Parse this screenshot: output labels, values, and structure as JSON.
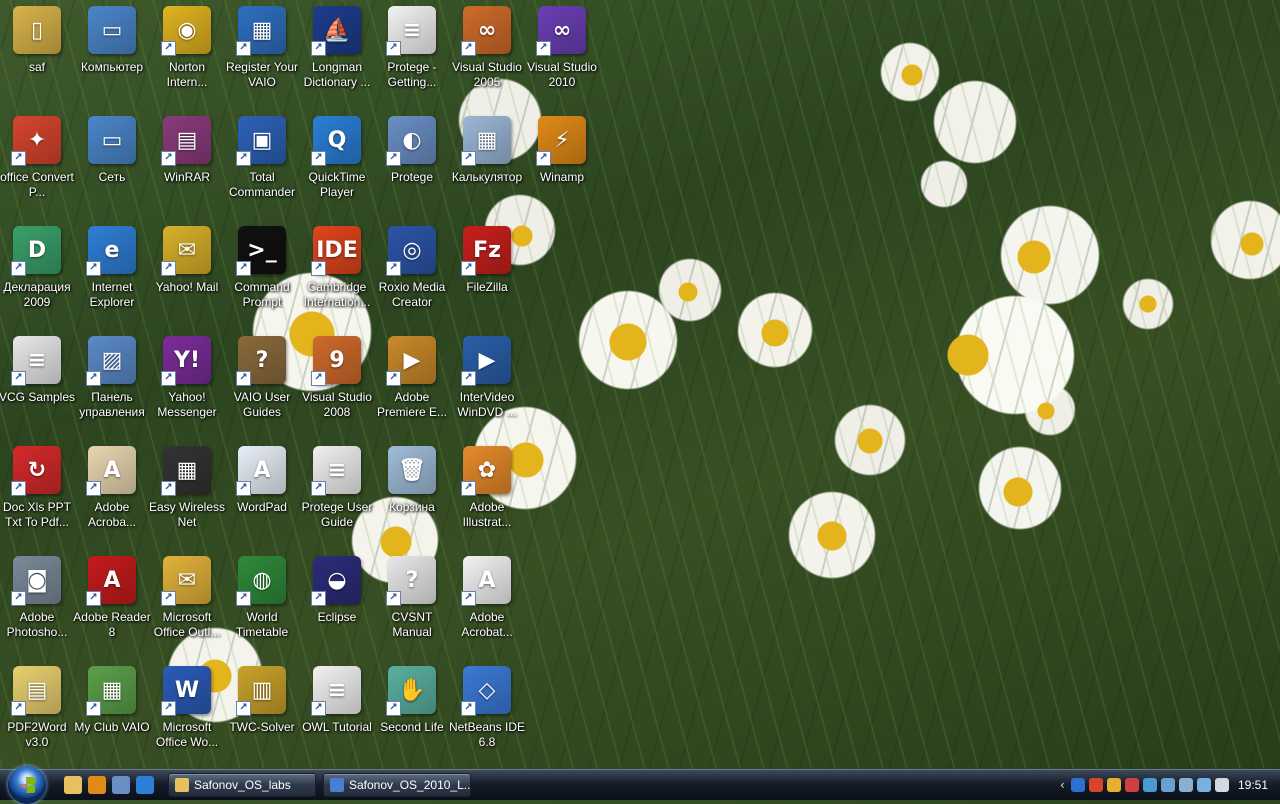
{
  "desktop": {
    "icons": [
      {
        "label": "saf",
        "color": "#d8b34a",
        "glyph": "▯"
      },
      {
        "label": "Компьютер",
        "color": "#4b86c9",
        "glyph": "▭"
      },
      {
        "label": "Norton Intern...",
        "color": "#e0b321",
        "glyph": "◉"
      },
      {
        "label": "Register Your VAIO",
        "color": "#2f6fc0",
        "glyph": "▦"
      },
      {
        "label": "Longman Dictionary ...",
        "color": "#1e3c8c",
        "glyph": "⛵"
      },
      {
        "label": "Protege - Getting...",
        "color": "#f2f2f2",
        "glyph": "≡"
      },
      {
        "label": "Visual Studio 2005",
        "color": "#cf6b2a",
        "glyph": "∞"
      },
      {
        "label": "Visual Studio 2010",
        "color": "#6b3fb5",
        "glyph": "∞"
      },
      {
        "label": "office Convert P...",
        "color": "#d6452e",
        "glyph": "✦"
      },
      {
        "label": "Сеть",
        "color": "#4b86c9",
        "glyph": "▭"
      },
      {
        "label": "WinRAR",
        "color": "#8a3b7c",
        "glyph": "▤"
      },
      {
        "label": "Total Commander",
        "color": "#2d62b8",
        "glyph": "▣"
      },
      {
        "label": "QuickTime Player",
        "color": "#2a7fd6",
        "glyph": "Q"
      },
      {
        "label": "Protege",
        "color": "#6a8fc4",
        "glyph": "◐"
      },
      {
        "label": "Калькулятор",
        "color": "#9bb7d6",
        "glyph": "▦"
      },
      {
        "label": "Winamp",
        "color": "#e08a18",
        "glyph": "⚡"
      },
      {
        "label": "Декларация 2009",
        "color": "#3aa06a",
        "glyph": "D"
      },
      {
        "label": "Internet Explorer",
        "color": "#2f7fd6",
        "glyph": "e"
      },
      {
        "label": "Yahoo! Mail",
        "color": "#d9b02a",
        "glyph": "✉"
      },
      {
        "label": "Command Prompt",
        "color": "#111111",
        "glyph": ">_"
      },
      {
        "label": "Cambridge Internation...",
        "color": "#e0451c",
        "glyph": "IDE"
      },
      {
        "label": "Roxio Media Creator",
        "color": "#2c55a8",
        "glyph": "◎"
      },
      {
        "label": "FileZilla",
        "color": "#c8201c",
        "glyph": "Fz"
      },
      {
        "label": "VCG Samples",
        "color": "#e8e8e8",
        "glyph": "≡"
      },
      {
        "label": "Панель управления",
        "color": "#5b8ac8",
        "glyph": "▨"
      },
      {
        "label": "Yahoo! Messenger",
        "color": "#7b2d9a",
        "glyph": "Y!"
      },
      {
        "label": "VAIO User Guides",
        "color": "#8a6a3c",
        "glyph": "?"
      },
      {
        "label": "Visual Studio 2008",
        "color": "#d06a2b",
        "glyph": "9"
      },
      {
        "label": "Adobe Premiere E...",
        "color": "#c98a2a",
        "glyph": "▶"
      },
      {
        "label": "InterVideo WinDVD ...",
        "color": "#2a5fa8",
        "glyph": "▶"
      },
      {
        "label": "Doc Xls PPT Txt To Pdf...",
        "color": "#d42a2a",
        "glyph": "↻"
      },
      {
        "label": "Adobe Acroba...",
        "color": "#e8d6b0",
        "glyph": "A"
      },
      {
        "label": "Easy Wireless Net",
        "color": "#333333",
        "glyph": "▦"
      },
      {
        "label": "WordPad",
        "color": "#e8eef8",
        "glyph": "A"
      },
      {
        "label": "Protege User Guide",
        "color": "#f0f0f0",
        "glyph": "≡"
      },
      {
        "label": "Корзина",
        "color": "#9fbcd8",
        "glyph": "🗑"
      },
      {
        "label": "Adobe Illustrat...",
        "color": "#e58a2a",
        "glyph": "✿"
      },
      {
        "label": "Adobe Photosho...",
        "color": "#7a8a9a",
        "glyph": "◙"
      },
      {
        "label": "Adobe Reader 8",
        "color": "#c41c1c",
        "glyph": "A"
      },
      {
        "label": "Microsoft Office Outl...",
        "color": "#e2b23a",
        "glyph": "✉"
      },
      {
        "label": "World Timetable",
        "color": "#2f8a3a",
        "glyph": "◍"
      },
      {
        "label": "Eclipse",
        "color": "#2c2c7a",
        "glyph": "◒"
      },
      {
        "label": "CVSNT Manual",
        "color": "#e8e8e8",
        "glyph": "?"
      },
      {
        "label": "Adobe Acrobat...",
        "color": "#f2f2f2",
        "glyph": "A"
      },
      {
        "label": "PDF2Word v3.0",
        "color": "#e8d070",
        "glyph": "▤"
      },
      {
        "label": "My Club VAIO",
        "color": "#5aa04a",
        "glyph": "▦"
      },
      {
        "label": "Microsoft Office Wo...",
        "color": "#2b5bb8",
        "glyph": "W"
      },
      {
        "label": "TWC-Solver",
        "color": "#c9a22a",
        "glyph": "▥"
      },
      {
        "label": "OWL Tutorial",
        "color": "#f2f2f2",
        "glyph": "≡"
      },
      {
        "label": "Second Life",
        "color": "#5ab0a0",
        "glyph": "✋"
      },
      {
        "label": "NetBeans IDE 6.8",
        "color": "#3b7ad6",
        "glyph": "◇"
      }
    ]
  },
  "taskbar": {
    "start_label": "Start",
    "quick_launch": [
      {
        "name": "show-desktop",
        "color": "#e8c060"
      },
      {
        "name": "winamp-ql",
        "color": "#e08a18"
      },
      {
        "name": "switch-windows",
        "color": "#6a8fc4"
      },
      {
        "name": "internet-explorer-ql",
        "color": "#2f7fd6"
      }
    ],
    "windows": [
      {
        "title": "Safonov_OS_labs",
        "color": "#e8c060"
      },
      {
        "title": "Safonov_OS_2010_L...",
        "color": "#4a7fd0"
      }
    ],
    "tray_icons": [
      {
        "name": "bluetooth",
        "color": "#2f6fd0"
      },
      {
        "name": "antivirus",
        "color": "#d8442a"
      },
      {
        "name": "messenger",
        "color": "#e8b030"
      },
      {
        "name": "display",
        "color": "#d04040"
      },
      {
        "name": "network-monitor",
        "color": "#4a9ad0"
      },
      {
        "name": "device",
        "color": "#6aa0d0"
      },
      {
        "name": "removable-media",
        "color": "#8ab0d0"
      },
      {
        "name": "network",
        "color": "#7ab0e0"
      },
      {
        "name": "volume",
        "color": "#d0d8e0"
      }
    ],
    "clock": "19:51"
  }
}
